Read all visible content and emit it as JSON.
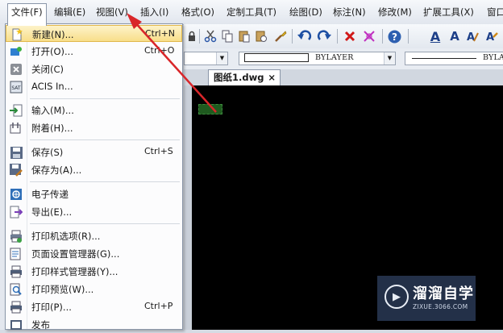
{
  "menubar": {
    "items": [
      "文件(F)",
      "编辑(E)",
      "视图(V)",
      "插入(I)",
      "格式(O)",
      "定制工具(T)",
      "绘图(D)",
      "标注(N)",
      "修改(M)",
      "扩展工具(X)",
      "窗口"
    ]
  },
  "file_menu": {
    "items": [
      {
        "label": "新建(N)...",
        "shortcut": "Ctrl+N",
        "icon": "new-file-icon"
      },
      {
        "label": "打开(O)...",
        "shortcut": "Ctrl+O",
        "icon": "open-folder-icon"
      },
      {
        "label": "关闭(C)",
        "shortcut": "",
        "icon": "close-icon"
      },
      {
        "label": "ACIS In...",
        "shortcut": "",
        "icon": "acis-icon"
      },
      {
        "label": "输入(M)...",
        "shortcut": "",
        "icon": "import-icon"
      },
      {
        "label": "附着(H)...",
        "shortcut": "",
        "icon": "attach-icon"
      },
      {
        "label": "保存(S)",
        "shortcut": "Ctrl+S",
        "icon": "save-icon"
      },
      {
        "label": "保存为(A)...",
        "shortcut": "",
        "icon": "save-as-icon"
      },
      {
        "label": "电子传递",
        "shortcut": "",
        "icon": "etransmit-icon"
      },
      {
        "label": "导出(E)...",
        "shortcut": "",
        "icon": "export-icon"
      },
      {
        "label": "打印机选项(R)...",
        "shortcut": "",
        "icon": "printer-options-icon"
      },
      {
        "label": "页面设置管理器(G)...",
        "shortcut": "",
        "icon": "page-setup-icon"
      },
      {
        "label": "打印样式管理器(Y)...",
        "shortcut": "",
        "icon": "plot-style-icon"
      },
      {
        "label": "打印预览(W)...",
        "shortcut": "",
        "icon": "print-preview-icon"
      },
      {
        "label": "打印(P)...",
        "shortcut": "Ctrl+P",
        "icon": "print-icon"
      },
      {
        "label": "发布",
        "shortcut": "",
        "icon": "publish-icon"
      }
    ]
  },
  "properties": {
    "linetype_value": "BYLAYER",
    "lineweight_value": "BYLA"
  },
  "document_tab": {
    "title": "图纸1.dwg",
    "close_glyph": "×"
  },
  "toolbar_glyphs": {
    "font_a1": "A",
    "font_a2": "A"
  },
  "watermark": {
    "title": "溜溜自学",
    "url": "ZIXUE.3066.COM"
  },
  "colors": {
    "highlight": "#f8de8a",
    "arrow": "#d9262a",
    "canvas": "#000000"
  }
}
